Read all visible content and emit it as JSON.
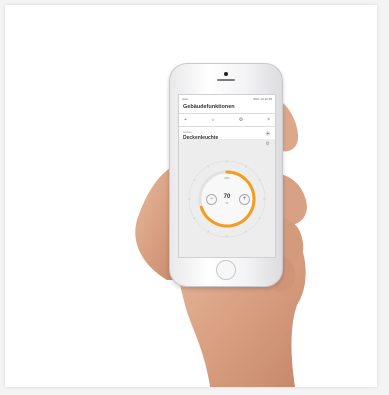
{
  "status_bar": {
    "carrier": "vitec",
    "battery": "90%",
    "time": "13:12 55"
  },
  "app": {
    "title": "Gebäudefunktionen"
  },
  "toolbar_icons": [
    "plus-icon",
    "sun-icon",
    "settings-icon",
    "close-icon"
  ],
  "room": {
    "label": "Stehen",
    "name": "Deckenleuchte"
  },
  "dimmer": {
    "value": "70",
    "unit": "%",
    "small_label": "60%",
    "level": 0.7
  },
  "colors": {
    "accent": "#f39c1f"
  }
}
